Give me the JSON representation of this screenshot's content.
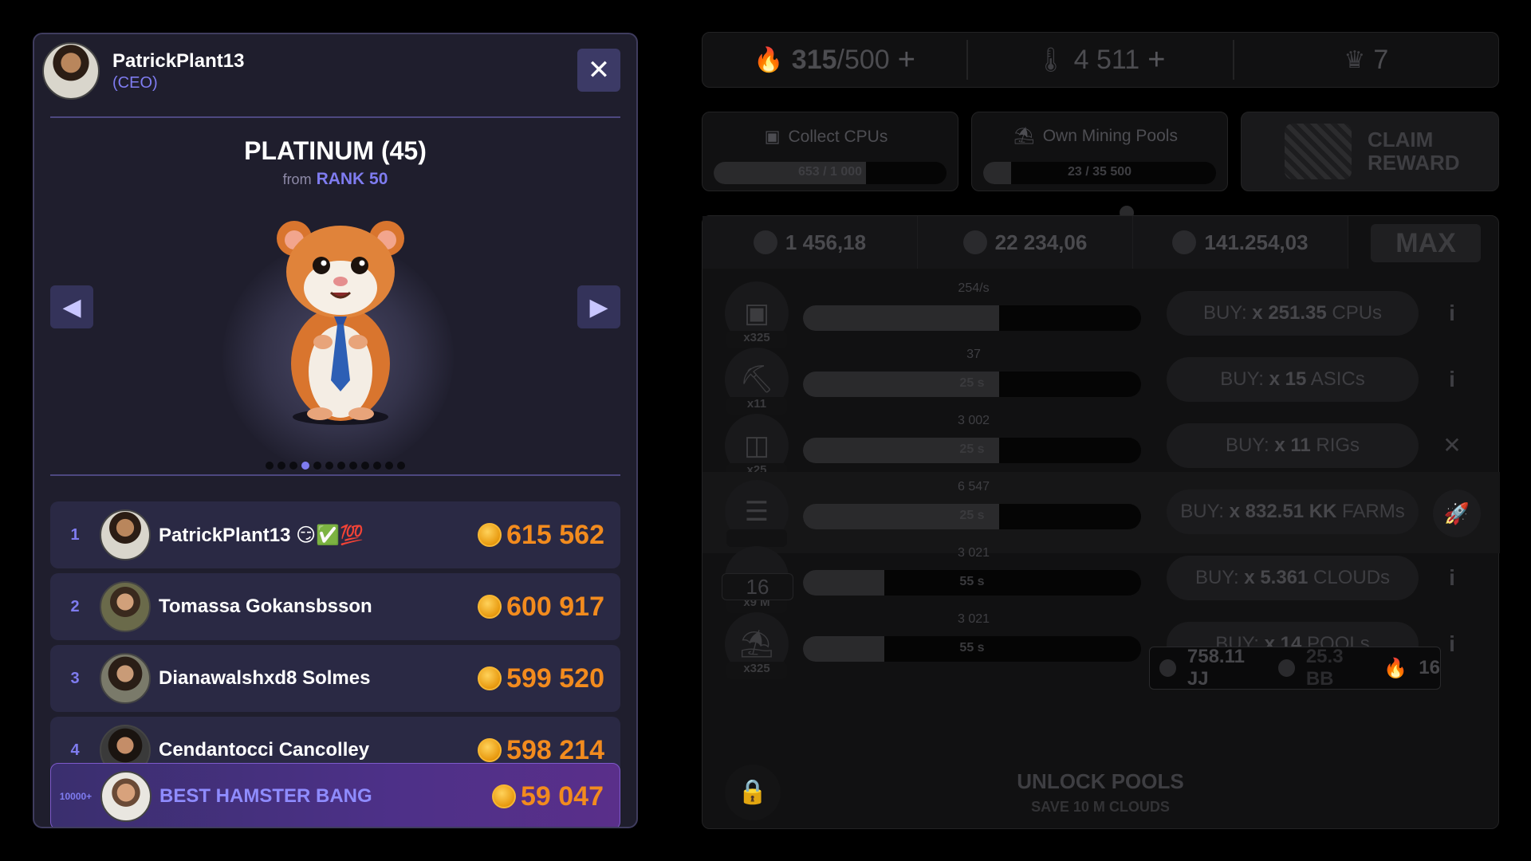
{
  "modal": {
    "user": {
      "name": "PatrickPlant13",
      "role": "(CEO)"
    },
    "close_label": "✕",
    "level": {
      "title": "PLATINUM (45)",
      "from_text": "from",
      "rank_text": "RANK 50"
    },
    "nav": {
      "prev": "◀",
      "next": "▶"
    },
    "dots_count": 12,
    "active_dot": 3,
    "leaderboard": [
      {
        "rank": "1",
        "name": "PatrickPlant13 😏✅💯",
        "score": "615 562"
      },
      {
        "rank": "2",
        "name": "Tomassa Gokansbsson",
        "score": "600 917"
      },
      {
        "rank": "3",
        "name": "Dianawalshxd8 Solmes",
        "score": "599 520"
      },
      {
        "rank": "4",
        "name": "Cendantocci Cancolley",
        "score": "598 214"
      }
    ],
    "me": {
      "rank": "10000+",
      "name": "BEST HAMSTER BANG",
      "score": "59 047"
    }
  },
  "right": {
    "stats": [
      {
        "icon": "flame-icon",
        "glyph": "🔥",
        "value": "315",
        "max": "/500",
        "plus": "+"
      },
      {
        "icon": "thermometer-icon",
        "glyph": "🌡",
        "value": "4 511",
        "max": "",
        "plus": "+"
      },
      {
        "icon": "crown-icon",
        "glyph": "♛",
        "value": "7",
        "max": "",
        "plus": ""
      }
    ],
    "tasks": [
      {
        "icon": "cpu-icon",
        "glyph": "▣",
        "label": "Collect CPUs",
        "progress": "653 / 1 000",
        "fraction": 0.653
      },
      {
        "icon": "pool-icon",
        "glyph": "⛱",
        "label": "Own Mining Pools",
        "progress": "23 / 35 500",
        "fraction": 0.02
      }
    ],
    "claim": {
      "line1": "CLAIM",
      "line2": "REWARD"
    },
    "currencies": [
      {
        "icon": "bitcoin-icon",
        "value": "1 456,18"
      },
      {
        "icon": "ethereum-icon",
        "value": "22 234,06"
      },
      {
        "icon": "tron-icon",
        "value": "141.254,03"
      }
    ],
    "max_label": "MAX",
    "miners": [
      {
        "icon": "cpu-icon",
        "glyph": "▣",
        "mult": "x325",
        "rate": "254/s",
        "time": "",
        "fill": 0.58,
        "buy_prefix": "BUY: ",
        "buy_amount": "x 251.35",
        "buy_unit": " CPUs",
        "side": "i"
      },
      {
        "icon": "pickaxe-icon",
        "glyph": "⛏",
        "mult": "x11",
        "rate": "37",
        "time": "25 s",
        "fill": 0.58,
        "buy_prefix": "BUY: ",
        "buy_amount": "x 15",
        "buy_unit": " ASICs",
        "side": "i"
      },
      {
        "icon": "gpu-rig-icon",
        "glyph": "◫",
        "mult": "x25",
        "rate": "3 002",
        "time": "25 s",
        "fill": 0.58,
        "buy_prefix": "BUY: ",
        "buy_amount": "x 11",
        "buy_unit": " RIGs",
        "side": "✕"
      },
      {
        "icon": "server-farm-icon",
        "glyph": "☰",
        "mult": "",
        "rate": "6 547",
        "time": "25 s",
        "fill": 0.58,
        "buy_prefix": "BUY: ",
        "buy_amount": "x 832.51 KK",
        "buy_unit": " FARMs",
        "side": "rocket"
      },
      {
        "icon": "cloud-icon",
        "glyph": "☁",
        "mult": "x9 M",
        "rate": "3 021",
        "time": "55 s",
        "fill": 0.24,
        "buy_prefix": "BUY: ",
        "buy_amount": "x 5.361",
        "buy_unit": " CLOUDs",
        "side": "i"
      },
      {
        "icon": "pool-icon",
        "glyph": "⛱",
        "mult": "x325",
        "rate": "3 021",
        "time": "55 s",
        "fill": 0.24,
        "buy_prefix": "BUY: ",
        "buy_amount": "x 14",
        "buy_unit": " POOLs",
        "side": "i"
      }
    ],
    "badge": "16",
    "tooltip": {
      "btc": "758.11 JJ",
      "eth": "25.3 BB",
      "flame": "16"
    },
    "unlock": {
      "title": "UNLOCK POOLS",
      "sub": "SAVE 10 M CLOUDS"
    }
  }
}
